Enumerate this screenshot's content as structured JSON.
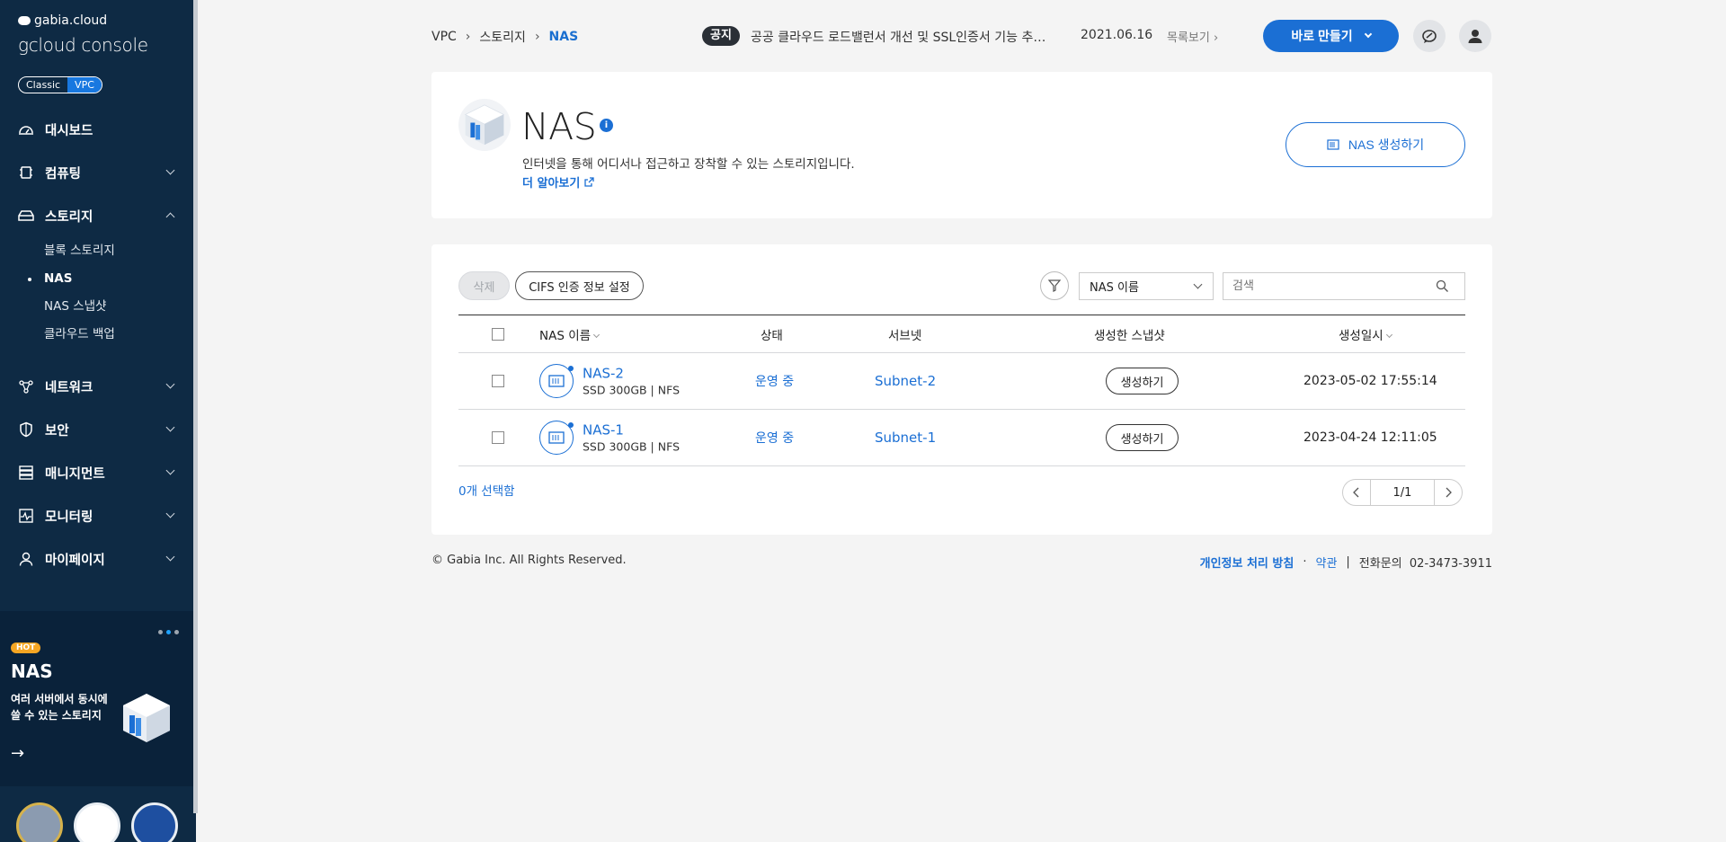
{
  "sidebar": {
    "brand_top": "gabia.cloud",
    "brand_main": "gcloud console",
    "toggle": [
      "Classic",
      "VPC"
    ],
    "nav": [
      {
        "label": "대시보드",
        "icon": "dashboard-icon"
      },
      {
        "label": "컴퓨팅",
        "icon": "computing-icon"
      },
      {
        "label": "스토리지",
        "icon": "storage-icon"
      },
      {
        "label": "네트워크",
        "icon": "network-icon"
      },
      {
        "label": "보안",
        "icon": "security-icon"
      },
      {
        "label": "매니지먼트",
        "icon": "management-icon"
      },
      {
        "label": "모니터링",
        "icon": "monitoring-icon"
      },
      {
        "label": "마이페이지",
        "icon": "mypage-icon"
      }
    ],
    "storage_sub": [
      "블록 스토리지",
      "NAS",
      "NAS 스냅샷",
      "클라우드 백업"
    ],
    "promo": {
      "tag": "HOT",
      "title": "NAS",
      "desc_line1": "여러 서버에서 동시에",
      "desc_line2": "쓸 수 있는 스토리지",
      "arrow": "→"
    }
  },
  "header": {
    "breadcrumb": [
      "VPC",
      "스토리지",
      "NAS"
    ],
    "notice_tag": "공지",
    "notice_text": "공공 클라우드 로드밸런서 개선 및 SSL인증서 기능 추가 안내",
    "notice_date": "2021.06.16",
    "notice_more": "목록보기",
    "create_button": "바로 만들기"
  },
  "page": {
    "title": "NAS",
    "desc": "인터넷을 통해 어디서나 접근하고 장착할 수 있는 스토리지입니다.",
    "learn_more": "더 알아보기",
    "create_nas": "NAS 생성하기"
  },
  "toolbar": {
    "delete": "삭제",
    "cifs": "CIFS 인증 정보 설정",
    "select_value": "NAS 이름",
    "search_placeholder": "검색"
  },
  "table": {
    "headers": [
      "NAS 이름",
      "상태",
      "서브넷",
      "생성한 스냅샷",
      "생성일시"
    ],
    "rows": [
      {
        "name": "NAS-2",
        "meta": "SSD 300GB  |  NFS",
        "status": "운영 중",
        "subnet": "Subnet-2",
        "snapshot": "생성하기",
        "created": "2023-05-02 17:55:14"
      },
      {
        "name": "NAS-1",
        "meta": "SSD 300GB  |  NFS",
        "status": "운영 중",
        "subnet": "Subnet-1",
        "snapshot": "생성하기",
        "created": "2023-04-24 12:11:05"
      }
    ],
    "selected_count": "0개 선택함",
    "page": "1/1"
  },
  "footer": {
    "copyright": "© Gabia Inc. All Rights Reserved.",
    "privacy": "개인정보 처리 방침",
    "dot": "·",
    "terms": "약관",
    "bar": "|",
    "phone": "전화문의  02-3473-3911"
  }
}
